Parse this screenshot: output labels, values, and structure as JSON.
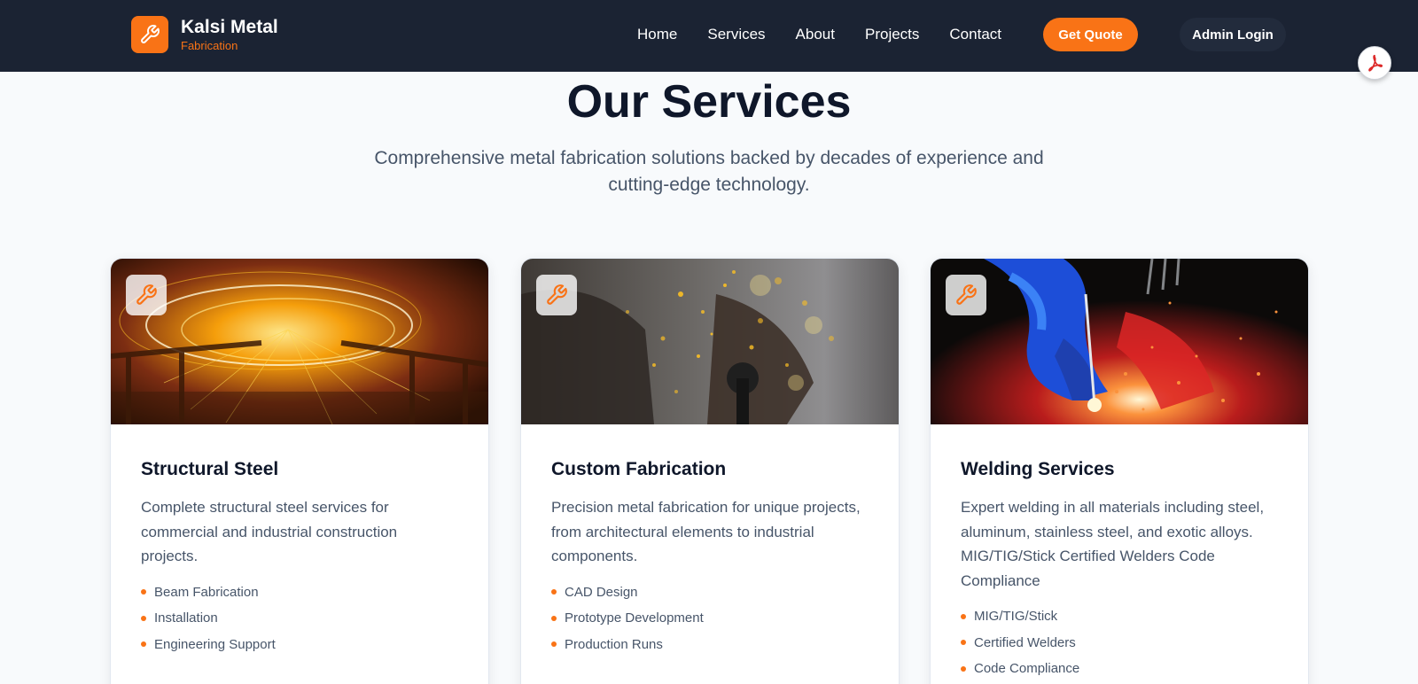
{
  "brand": {
    "name": "Kalsi Metal",
    "sub": "Fabrication",
    "logo_icon": "wrench-icon"
  },
  "nav": {
    "links": [
      "Home",
      "Services",
      "About",
      "Projects",
      "Contact"
    ],
    "quote_label": "Get Quote",
    "admin_label": "Admin Login",
    "pdf_icon": "pdf-icon"
  },
  "section": {
    "title": "Our Services",
    "subtitle": "Comprehensive metal fabrication solutions backed by decades of experience and cutting-edge technology."
  },
  "cards": [
    {
      "title": "Structural Steel",
      "description": "Complete structural steel services for commercial and industrial construction projects.",
      "features": [
        "Beam Fabrication",
        "Installation",
        "Engineering Support"
      ],
      "badge_icon": "wrench-icon"
    },
    {
      "title": "Custom Fabrication",
      "description": "Precision metal fabrication for unique projects, from architectural elements to industrial components.",
      "features": [
        "CAD Design",
        "Prototype Development",
        "Production Runs"
      ],
      "badge_icon": "wrench-icon"
    },
    {
      "title": "Welding Services",
      "description": "Expert welding in all materials including steel, aluminum, stainless steel, and exotic alloys. MIG/TIG/Stick Certified Welders Code Compliance",
      "features": [
        "MIG/TIG/Stick",
        "Certified Welders",
        "Code Compliance"
      ],
      "badge_icon": "wrench-icon"
    }
  ],
  "colors": {
    "accent": "#f97316",
    "nav_bg": "#1b2333",
    "page_bg": "#f8fafc"
  }
}
